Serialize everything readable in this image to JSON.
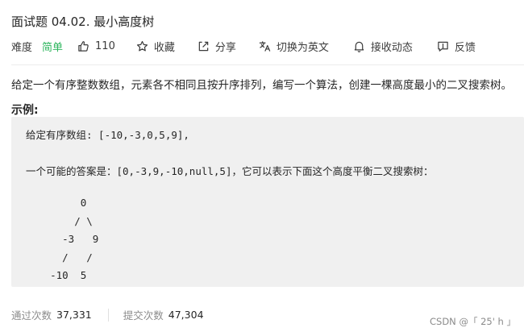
{
  "problem": {
    "title": "面试题 04.02. 最小高度树"
  },
  "meta": {
    "difficulty_label": "难度",
    "difficulty_value": "简单",
    "likes": "110",
    "favorite_label": "收藏",
    "share_label": "分享",
    "lang_switch_label": "切换为英文",
    "notify_label": "接收动态",
    "feedback_label": "反馈"
  },
  "description": "给定一个有序整数数组，元素各不相同且按升序排列，编写一个算法，创建一棵高度最小的二叉搜索树。",
  "example": {
    "heading": "示例:",
    "line1": "给定有序数组: [-10,-3,0,5,9],",
    "line2": "一个可能的答案是：[0,-3,9,-10,null,5]，它可以表示下面这个高度平衡二叉搜索树：",
    "tree": "         0\n        / \\\n      -3   9\n      /   /\n    -10  5"
  },
  "stats": {
    "accepted_label": "通过次数",
    "accepted_value": "37,331",
    "submitted_label": "提交次数",
    "submitted_value": "47,304"
  },
  "watermark": "CSDN @「 25' h 」",
  "colors": {
    "easy": "#2db55d",
    "text": "#262626",
    "muted": "#8c8c8c",
    "code_bg": "#f0f0f0"
  },
  "icons": {
    "like": "thumbs-up-icon",
    "favorite": "star-icon",
    "share": "share-icon",
    "lang": "translate-icon",
    "notify": "bell-icon",
    "feedback": "feedback-icon"
  }
}
